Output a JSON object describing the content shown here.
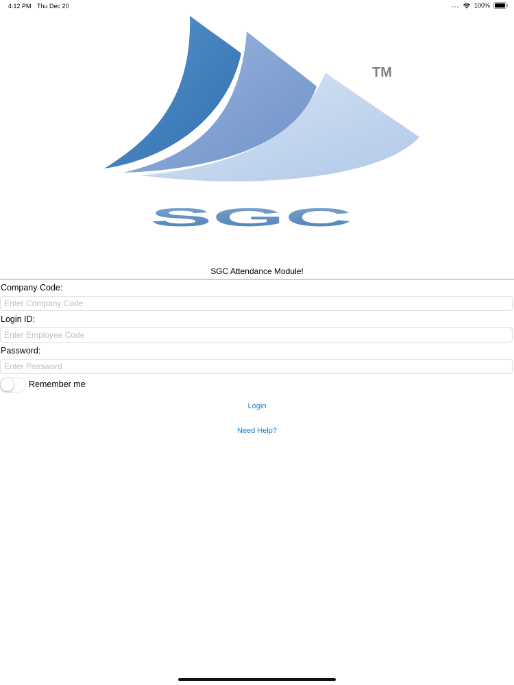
{
  "status_bar": {
    "time": "4:12 PM",
    "date": "Thu Dec 20",
    "battery": "100%",
    "icons": [
      "signal-icon",
      "wifi-icon",
      "battery-icon"
    ]
  },
  "logo": {
    "text": "SGC",
    "trademark": "TM",
    "colors": {
      "sail_dark": "#3f7fbf",
      "sail_mid": "#7d9fd0",
      "sail_light": "#c3d6ee",
      "letters": "#5f8fbf"
    }
  },
  "header": {
    "title": "SGC Attendance Module!"
  },
  "form": {
    "company_code": {
      "label": "Company Code:",
      "placeholder": "Enter Company Code",
      "value": ""
    },
    "login_id": {
      "label": "Login ID:",
      "placeholder": "Enter Employee Code",
      "value": ""
    },
    "password": {
      "label": "Password:",
      "placeholder": "Enter Password",
      "value": ""
    },
    "remember_me": {
      "label": "Remember me",
      "checked": false
    }
  },
  "actions": {
    "login_label": "Login",
    "help_label": "Need Help?"
  },
  "colors": {
    "link": "#1a7fd4",
    "divider": "#6aa8a0"
  }
}
